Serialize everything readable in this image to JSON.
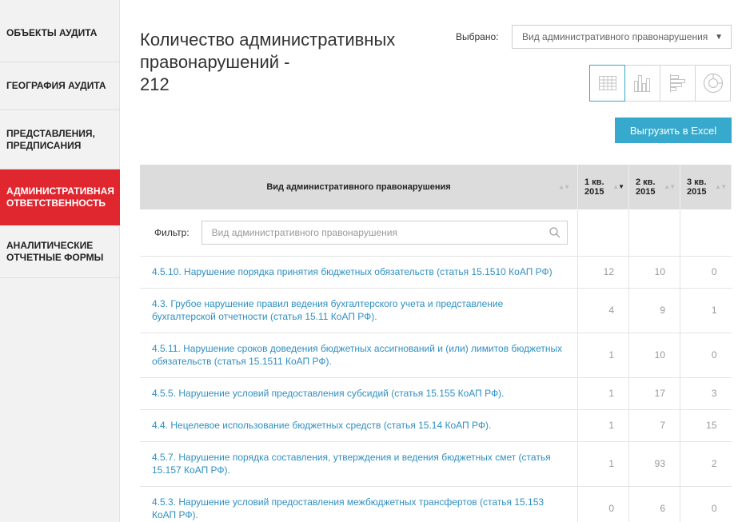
{
  "sidebar": {
    "items": [
      {
        "label": "ОБЪЕКТЫ АУДИТА",
        "active": false
      },
      {
        "label": "ГЕОГРАФИЯ АУДИТА",
        "active": false
      },
      {
        "label": "ПРЕДСТАВЛЕНИЯ, ПРЕДПИСАНИЯ",
        "active": false
      },
      {
        "label": "АДМИНИСТРАТИВНАЯ ОТВЕТСТВЕННОСТЬ",
        "active": true
      },
      {
        "label": "АНАЛИТИЧЕСКИЕ ОТЧЕТНЫЕ ФОРМЫ",
        "active": false
      }
    ]
  },
  "header": {
    "title_line1": "Количество административных",
    "title_line2": "правонарушений -",
    "title_count": "212",
    "selected_label": "Выбрано:",
    "selected_value": "Вид административного правонарушения"
  },
  "views": {
    "active": "table",
    "icons": [
      "table-view-icon",
      "bar-chart-view-icon",
      "hbar-chart-view-icon",
      "pie-chart-view-icon"
    ]
  },
  "export_label": "Выгрузить в Excel",
  "colors": {
    "accent_red": "#e0262e",
    "accent_blue": "#36a9cc",
    "link_blue": "#2f8fc2",
    "header_gray": "#dcdcdc"
  },
  "table": {
    "columns": [
      {
        "label": "Вид административного правонарушения"
      },
      {
        "label_top": "1 кв.",
        "label_bottom": "2015",
        "sorted": "desc"
      },
      {
        "label_top": "2 кв.",
        "label_bottom": "2015"
      },
      {
        "label_top": "3 кв.",
        "label_bottom": "2015"
      }
    ],
    "filter_label": "Фильтр:",
    "filter_placeholder": "Вид административного правонарушения",
    "rows": [
      {
        "name": "4.5.10. Нарушение порядка принятия бюджетных обязательств (статья 15.1510 КоАП РФ)",
        "q1": "12",
        "q2": "10",
        "q3": "0"
      },
      {
        "name": "4.3. Грубое нарушение правил ведения бухгалтерского учета и представление бухгалтерской отчетности (статья 15.11 КоАП РФ).",
        "q1": "4",
        "q2": "9",
        "q3": "1"
      },
      {
        "name": "4.5.11. Нарушение сроков доведения бюджетных ассигнований и (или) лимитов бюджетных обязательств (статья 15.1511 КоАП РФ).",
        "q1": "1",
        "q2": "10",
        "q3": "0"
      },
      {
        "name": "4.5.5. Нарушение условий предоставления субсидий (статья 15.155 КоАП РФ).",
        "q1": "1",
        "q2": "17",
        "q3": "3"
      },
      {
        "name": "4.4. Нецелевое использование бюджетных средств (статья 15.14 КоАП РФ).",
        "q1": "1",
        "q2": "7",
        "q3": "15"
      },
      {
        "name": "4.5.7. Нарушение порядка составления, утверждения и ведения бюджетных смет (статья 15.157 КоАП РФ).",
        "q1": "1",
        "q2": "93",
        "q3": "2"
      },
      {
        "name": "4.5.3. Нарушение условий предоставления межбюджетных трансфертов (статья 15.153 КоАП РФ).",
        "q1": "0",
        "q2": "6",
        "q3": "0"
      }
    ]
  }
}
